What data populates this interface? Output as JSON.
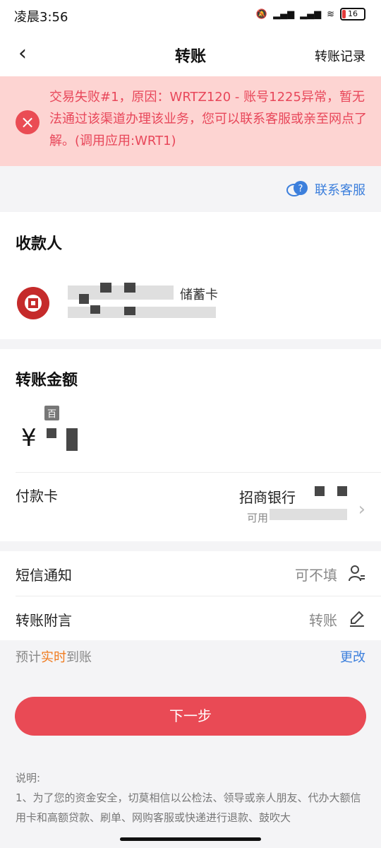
{
  "status_bar": {
    "time": "凌晨3:56",
    "battery": "16"
  },
  "nav": {
    "title": "转账",
    "history_label": "转账记录"
  },
  "error": {
    "message": "交易失败#1，原因：WRTZ120 - 账号1225异常，暂无法通过该渠道办理该业务，您可以联系客服或亲至网点了解。(调用应用:WRT1)"
  },
  "support": {
    "label": "联系客服"
  },
  "payee": {
    "section_title": "收款人",
    "card_type": "储蓄卡"
  },
  "amount": {
    "section_title": "转账金额",
    "unit_tag": "百",
    "currency_symbol": "¥"
  },
  "pay_card": {
    "label": "付款卡",
    "bank": "招商银行",
    "available_prefix": "可用"
  },
  "sms": {
    "label": "短信通知",
    "placeholder": "可不填"
  },
  "remark": {
    "label": "转账附言",
    "value": "转账"
  },
  "arrival": {
    "prefix": "预计",
    "highlight": "实时",
    "suffix": "到账",
    "change_label": "更改"
  },
  "next_button": "下一步",
  "notes": {
    "title": "说明:",
    "line1": "1、为了您的资金安全，切莫相信以公检法、领导或亲人朋友、代办大额信用卡和高额贷款、刷单、网购客服或快递进行退款、鼓吹大"
  },
  "colors": {
    "accent_red": "#e94a55",
    "error_text": "#e8475a",
    "link_blue": "#3c7fdc",
    "highlight_orange": "#f07b1f"
  }
}
